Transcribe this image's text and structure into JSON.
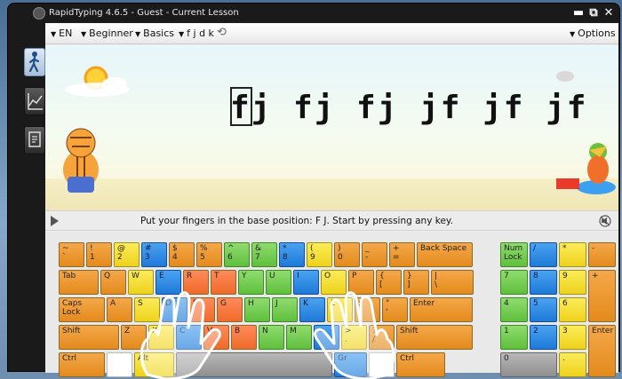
{
  "window": {
    "title": "RapidTyping 4.6.5 - Guest - Current Lesson",
    "minimize": "▬",
    "restore": "⧉",
    "close": "✕"
  },
  "sidebar": {
    "items": [
      {
        "name": "lesson-mode-button",
        "icon": "walking-person-icon"
      },
      {
        "name": "statistics-button",
        "icon": "chart-icon"
      },
      {
        "name": "course-editor-button",
        "icon": "document-icon"
      }
    ]
  },
  "menubar": {
    "language": "EN",
    "level": "Beginner",
    "course": "Basics",
    "lesson": "f j d k",
    "reload_icon": "refresh-icon",
    "options": "Options"
  },
  "lesson": {
    "text": "fj fj fj jf jf jf"
  },
  "status": {
    "message": "Put your fingers in the base position:  F J.  Start by pressing any key."
  },
  "keyboard": {
    "row1": [
      {
        "t": "~\n`",
        "c": "o"
      },
      {
        "t": "!\n1",
        "c": "o"
      },
      {
        "t": "@\n2",
        "c": "y"
      },
      {
        "t": "#\n3",
        "c": "b"
      },
      {
        "t": "$\n4",
        "c": "o"
      },
      {
        "t": "%\n5",
        "c": "o"
      },
      {
        "t": "^\n6",
        "c": "g"
      },
      {
        "t": "&\n7",
        "c": "g"
      },
      {
        "t": "*\n8",
        "c": "b"
      },
      {
        "t": "(\n9",
        "c": "y"
      },
      {
        "t": ")\n0",
        "c": "o"
      },
      {
        "t": "_\n-",
        "c": "o"
      },
      {
        "t": "+\n=",
        "c": "o"
      },
      {
        "t": "Back Space",
        "c": "o"
      }
    ],
    "row2": [
      {
        "t": "Tab",
        "c": "o"
      },
      {
        "t": "Q",
        "c": "o"
      },
      {
        "t": "W",
        "c": "y"
      },
      {
        "t": "E",
        "c": "b"
      },
      {
        "t": "R",
        "c": "r"
      },
      {
        "t": "T",
        "c": "r"
      },
      {
        "t": "Y",
        "c": "g"
      },
      {
        "t": "U",
        "c": "g"
      },
      {
        "t": "I",
        "c": "b"
      },
      {
        "t": "O",
        "c": "y"
      },
      {
        "t": "P",
        "c": "o"
      },
      {
        "t": "{\n[",
        "c": "o"
      },
      {
        "t": "}\n]",
        "c": "o"
      },
      {
        "t": "|\n\\",
        "c": "o"
      }
    ],
    "row3": [
      {
        "t": "Caps Lock",
        "c": "o"
      },
      {
        "t": "A",
        "c": "o"
      },
      {
        "t": "S",
        "c": "y"
      },
      {
        "t": "D",
        "c": "b"
      },
      {
        "t": "F",
        "c": "r"
      },
      {
        "t": "G",
        "c": "r"
      },
      {
        "t": "H",
        "c": "g"
      },
      {
        "t": "J",
        "c": "g"
      },
      {
        "t": "K",
        "c": "b"
      },
      {
        "t": "L",
        "c": "y"
      },
      {
        "t": ":\n;",
        "c": "o"
      },
      {
        "t": "\"\n'",
        "c": "o"
      },
      {
        "t": "Enter",
        "c": "o"
      }
    ],
    "row4": [
      {
        "t": "Shift",
        "c": "o"
      },
      {
        "t": "Z",
        "c": "o"
      },
      {
        "t": "X",
        "c": "y"
      },
      {
        "t": "C",
        "c": "b"
      },
      {
        "t": "V",
        "c": "r"
      },
      {
        "t": "B",
        "c": "r"
      },
      {
        "t": "N",
        "c": "g"
      },
      {
        "t": "M",
        "c": "g"
      },
      {
        "t": "<\n,",
        "c": "b"
      },
      {
        "t": ">\n.",
        "c": "y"
      },
      {
        "t": "?\n/",
        "c": "o"
      },
      {
        "t": "Shift",
        "c": "o"
      }
    ],
    "row5": [
      {
        "t": "Ctrl",
        "c": "o"
      },
      {
        "t": "",
        "c": "w"
      },
      {
        "t": "Alt",
        "c": "y"
      },
      {
        "t": "",
        "c": "gr"
      },
      {
        "t": "Gr",
        "c": "b"
      },
      {
        "t": "",
        "c": "w"
      },
      {
        "t": "Ctrl",
        "c": "o"
      }
    ],
    "numpad": [
      {
        "t": "Num\nLock",
        "c": "g"
      },
      {
        "t": "/",
        "c": "b"
      },
      {
        "t": "*",
        "c": "y"
      },
      {
        "t": "-",
        "c": "o"
      },
      {
        "t": "7",
        "c": "g"
      },
      {
        "t": "8",
        "c": "b"
      },
      {
        "t": "9",
        "c": "y"
      },
      {
        "t": "+",
        "c": "o"
      },
      {
        "t": "4",
        "c": "g"
      },
      {
        "t": "5",
        "c": "b"
      },
      {
        "t": "6",
        "c": "y"
      },
      {
        "t": "1",
        "c": "g"
      },
      {
        "t": "2",
        "c": "b"
      },
      {
        "t": "3",
        "c": "y"
      },
      {
        "t": "Enter",
        "c": "o"
      },
      {
        "t": "0",
        "c": "gr"
      },
      {
        "t": ".",
        "c": "y"
      }
    ]
  }
}
